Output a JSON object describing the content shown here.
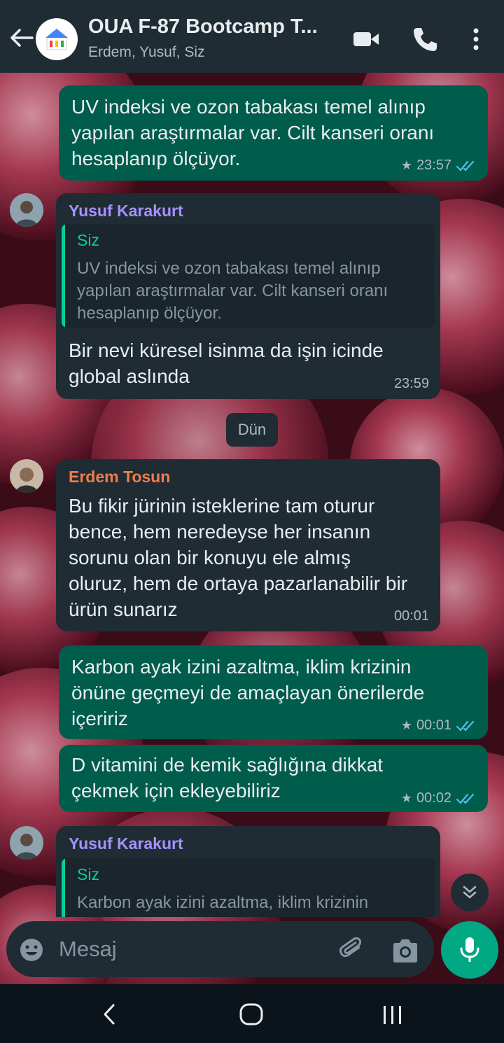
{
  "header": {
    "title": "OUA F-87 Bootcamp T...",
    "subtitle": "Erdem, Yusuf, Siz"
  },
  "messages": [
    {
      "type": "outgoing",
      "lines": [
        "UV indeksi ve ozon tabakası temel alınıp",
        "yapılan araştırmalar var. Cilt kanseri oranı",
        "hesaplanıp ölçüyor."
      ],
      "time": "23:57",
      "starred": true,
      "status": "read"
    },
    {
      "type": "incoming",
      "sender": "Yusuf Karakurt",
      "sender_color": "#a791ff",
      "quote": {
        "author": "Siz",
        "lines": [
          "UV indeksi ve ozon tabakası temel alınıp",
          "yapılan araştırmalar var. Cilt kanseri oranı",
          "hesaplanıp ölçüyor."
        ]
      },
      "lines": [
        "Bir nevi küresel isinma da işin icinde",
        "global aslında"
      ],
      "time": "23:59"
    },
    {
      "type": "incoming",
      "sender": "Erdem Tosun",
      "sender_color": "#f37c4a",
      "lines": [
        "Bu fikir jürinin isteklerine tam oturur",
        "bence, hem neredeyse her insanın",
        "sorunu olan bir konuyu ele almış",
        "oluruz, hem de ortaya pazarlanabilir bir",
        "ürün sunarız"
      ],
      "time": "00:01"
    },
    {
      "type": "outgoing",
      "lines": [
        "Karbon ayak izini azaltma, iklim krizinin",
        "önüne geçmeyi de amaçlayan önerilerde",
        "içeririz"
      ],
      "time": "00:01",
      "starred": true,
      "status": "read"
    },
    {
      "type": "outgoing",
      "lines": [
        "D vitamini de kemik sağlığına dikkat",
        "çekmek için ekleyebiliriz"
      ],
      "time": "00:02",
      "starred": true,
      "status": "read"
    },
    {
      "type": "incoming",
      "sender": "Yusuf Karakurt",
      "sender_color": "#a791ff",
      "quote": {
        "author": "Siz",
        "lines": [
          "Karbon ayak izini azaltma, iklim krizinin"
        ]
      }
    }
  ],
  "day_divider": "Dün",
  "input": {
    "placeholder": "Mesaj"
  },
  "colors": {
    "header_bg": "#1f2c34",
    "outgoing_bubble": "#005c4b",
    "incoming_bubble": "#1f2c34",
    "accent": "#00a884",
    "read_ticks": "#53bdeb"
  },
  "icons": [
    "back-arrow-icon",
    "group-avatar",
    "video-call-icon",
    "voice-call-icon",
    "more-options-icon",
    "emoji-icon",
    "attach-icon",
    "camera-icon",
    "mic-icon",
    "scroll-down-icon",
    "nav-back-icon",
    "nav-home-icon",
    "nav-recents-icon"
  ]
}
